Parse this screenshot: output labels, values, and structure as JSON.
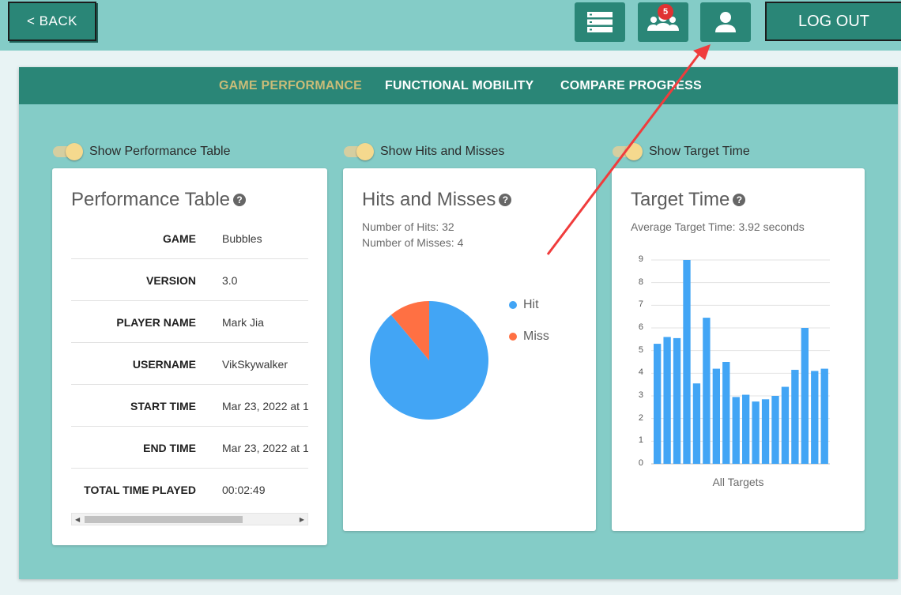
{
  "header": {
    "back_label": "< BACK",
    "badge_count": "5",
    "logout_label": "LOG OUT"
  },
  "tabs": [
    {
      "label": "GAME PERFORMANCE",
      "active": true
    },
    {
      "label": "FUNCTIONAL MOBILITY",
      "active": false
    },
    {
      "label": "COMPARE PROGRESS",
      "active": false
    }
  ],
  "toggles": [
    {
      "label": "Show Performance Table",
      "on": true
    },
    {
      "label": "Show Hits and Misses",
      "on": true
    },
    {
      "label": "Show Target Time",
      "on": true
    }
  ],
  "performance": {
    "title": "Performance Table",
    "rows": [
      {
        "key": "GAME",
        "value": "Bubbles"
      },
      {
        "key": "VERSION",
        "value": "3.0"
      },
      {
        "key": "PLAYER NAME",
        "value": "Mark Jia"
      },
      {
        "key": "USERNAME",
        "value": "VikSkywalker"
      },
      {
        "key": "START TIME",
        "value": "Mar 23, 2022 at 1"
      },
      {
        "key": "END TIME",
        "value": "Mar 23, 2022 at 1"
      },
      {
        "key": "TOTAL TIME PLAYED",
        "value": "00:02:49"
      }
    ]
  },
  "hits": {
    "title": "Hits and Misses",
    "hits_text": "Number of Hits: 32",
    "misses_text": "Number of Misses: 4",
    "legend": [
      {
        "label": "Hit",
        "color": "#42a5f5"
      },
      {
        "label": "Miss",
        "color": "#ff7043"
      }
    ]
  },
  "target": {
    "title": "Target Time",
    "subtitle": "Average Target Time: 3.92 seconds",
    "xlabel": "All Targets",
    "yticks": [
      "0",
      "1",
      "2",
      "3",
      "4",
      "5",
      "6",
      "7",
      "8",
      "9"
    ]
  },
  "chart_data": [
    {
      "type": "pie",
      "categories": [
        "Hit",
        "Miss"
      ],
      "values": [
        32,
        4
      ],
      "colors": [
        "#42a5f5",
        "#ff7043"
      ]
    },
    {
      "type": "bar",
      "xlabel": "All Targets",
      "ylim": [
        0,
        9
      ],
      "values": [
        5.3,
        5.6,
        5.55,
        9.0,
        3.55,
        6.45,
        4.2,
        4.5,
        2.95,
        3.05,
        2.75,
        2.85,
        3.0,
        3.4,
        4.15,
        6.0,
        4.1,
        4.2
      ],
      "color": "#42a5f5",
      "grid": true
    }
  ]
}
